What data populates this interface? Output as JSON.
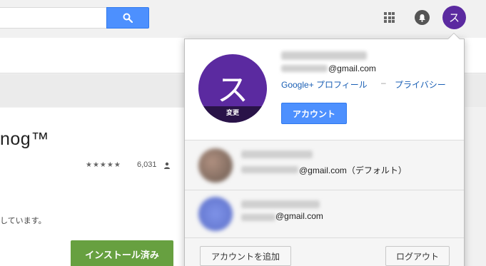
{
  "header": {
    "search_placeholder": "",
    "search_icon": "search-icon",
    "apps_icon": "apps-grid-icon",
    "notifications_icon": "bell-icon",
    "avatar_letter": "ス"
  },
  "app": {
    "title": "nog™",
    "stars": "★★★★★",
    "rating_count": "6,031",
    "description": "しています。",
    "install_label": "インストール済み"
  },
  "account_popup": {
    "avatar_letter": "ス",
    "avatar_change_label": "変更",
    "email_domain": "@gmail.com",
    "profile_link": "Google+ プロフィール",
    "separator": "–",
    "privacy_link": "プライバシー",
    "account_button": "アカウント",
    "other_accounts": [
      {
        "email_domain": "@gmail.com（デフォルト）",
        "avatar_color": "#8a7060"
      },
      {
        "email_domain": "@gmail.com",
        "avatar_color": "#6a7fd6"
      }
    ],
    "add_account_button": "アカウントを追加",
    "logout_button": "ログアウト"
  },
  "colors": {
    "accent_blue": "#4d90fe",
    "avatar_purple": "#5b2aa0",
    "install_green": "#67a040",
    "link_blue": "#1a5fb4"
  }
}
